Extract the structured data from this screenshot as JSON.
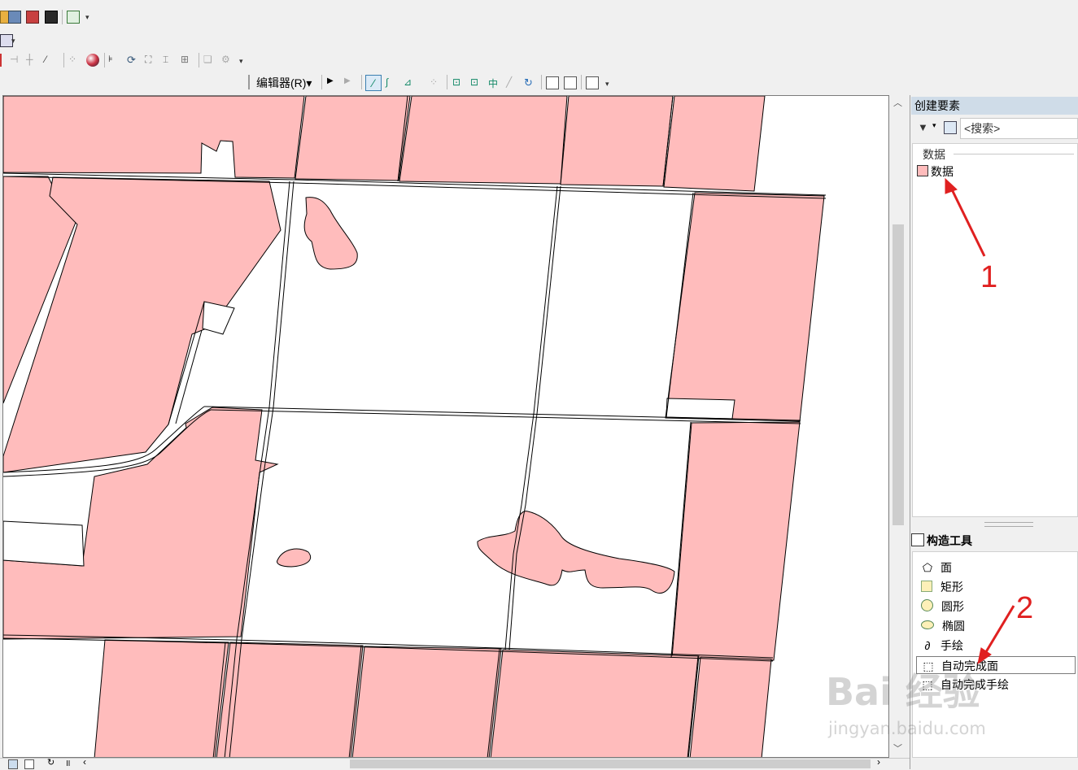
{
  "toolbar": {
    "editor_menu_label": "编辑器(R)▾"
  },
  "panel": {
    "title": "创建要素",
    "search_placeholder": "<搜索>",
    "group_label": "数据",
    "template_item": "数据",
    "construction_tools_title": "构造工具",
    "tools": [
      "面",
      "矩形",
      "圆形",
      "椭圆",
      "手绘",
      "自动完成面",
      "自动完成手绘"
    ]
  },
  "annotations": {
    "marker_1": "1",
    "marker_2": "2"
  },
  "watermark": {
    "main": "Bai 经验",
    "url": "jingyan.baidu.com"
  },
  "colors": {
    "polygon_fill": "#ffbcbc",
    "annotation": "#e02020",
    "panel_title_bg": "#cfdce8"
  }
}
